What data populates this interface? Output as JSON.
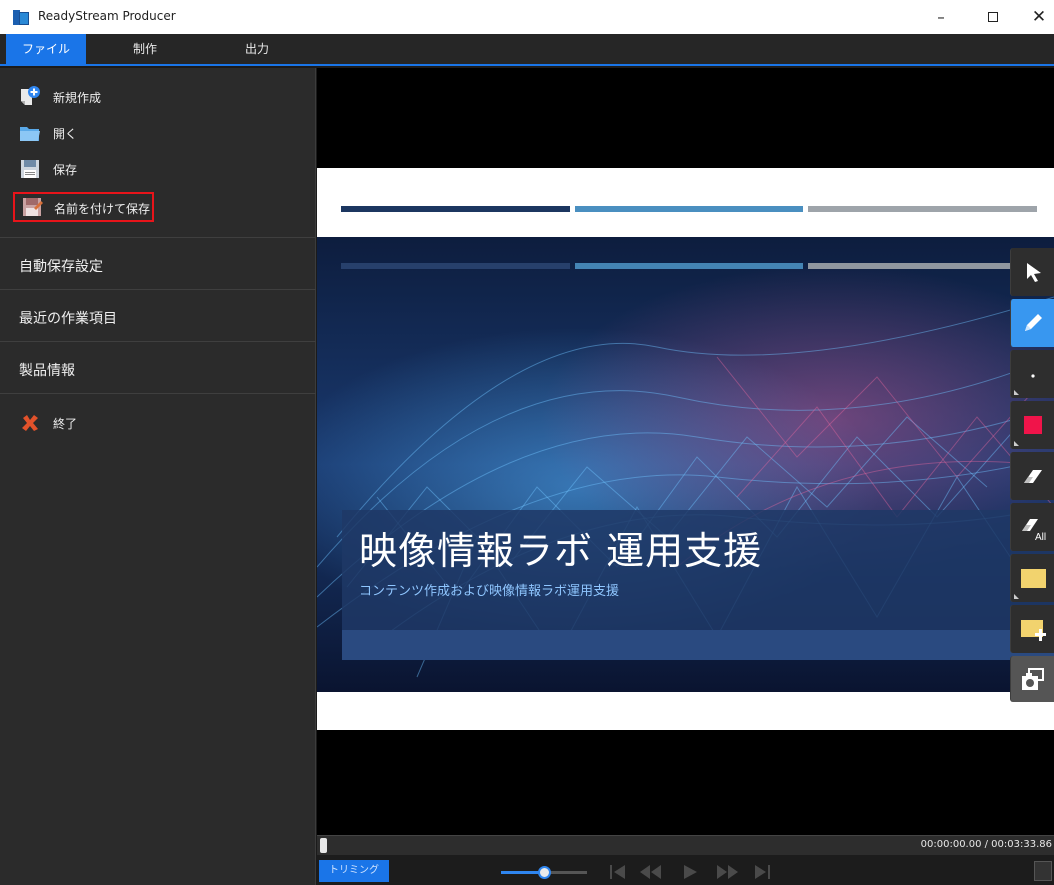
{
  "window": {
    "title": "ReadyStream Producer",
    "minimize_glyph": "–",
    "close_glyph": "✕"
  },
  "menu": {
    "tabs": [
      {
        "label": "ファイル",
        "active": true
      },
      {
        "label": "制作",
        "active": false
      },
      {
        "label": "出力",
        "active": false
      }
    ]
  },
  "file_menu": {
    "items": [
      {
        "label": "新規作成",
        "icon": "new-document-icon"
      },
      {
        "label": "開く",
        "icon": "folder-icon"
      },
      {
        "label": "保存",
        "icon": "floppy-disk-icon"
      },
      {
        "label": "名前を付けて保存",
        "icon": "save-as-icon",
        "highlighted": true
      }
    ],
    "sections": [
      {
        "label": "自動保存設定"
      },
      {
        "label": "最近の作業項目"
      },
      {
        "label": "製品情報"
      }
    ],
    "exit": {
      "label": "終了",
      "icon": "close-x-icon"
    }
  },
  "slide": {
    "title": "映像情報ラボ 運用支援",
    "subtitle": "コンテンツ作成および映像情報ラボ運用支援"
  },
  "tools": [
    {
      "name": "pointer-tool",
      "icon": "cursor-arrow-icon",
      "active": false
    },
    {
      "name": "pen-tool",
      "icon": "pen-icon",
      "active": true
    },
    {
      "name": "pen-size-tool",
      "icon": "dot-icon",
      "active": false
    },
    {
      "name": "pen-color-tool",
      "icon": "red-square-icon",
      "active": false
    },
    {
      "name": "eraser-tool",
      "icon": "eraser-icon",
      "active": false
    },
    {
      "name": "erase-all-tool",
      "icon": "eraser-all-icon",
      "active": false,
      "badge": "All"
    },
    {
      "name": "sticky-note-tool",
      "icon": "sticky-note-icon",
      "active": false
    },
    {
      "name": "add-sticky-note-tool",
      "icon": "sticky-note-add-icon",
      "active": false
    },
    {
      "name": "screenshot-tool",
      "icon": "camera-icon",
      "active": false
    }
  ],
  "timeline": {
    "position": 0.0,
    "time_display": "00:00:00.00 / 00:03:33.86",
    "trim_label": "トリミング",
    "volume": 0.5
  },
  "colors": {
    "accent": "#1a75e8",
    "highlight_border": "#e8141a",
    "panel_bg": "#2b2b2b",
    "active_tool": "#3897f0"
  }
}
